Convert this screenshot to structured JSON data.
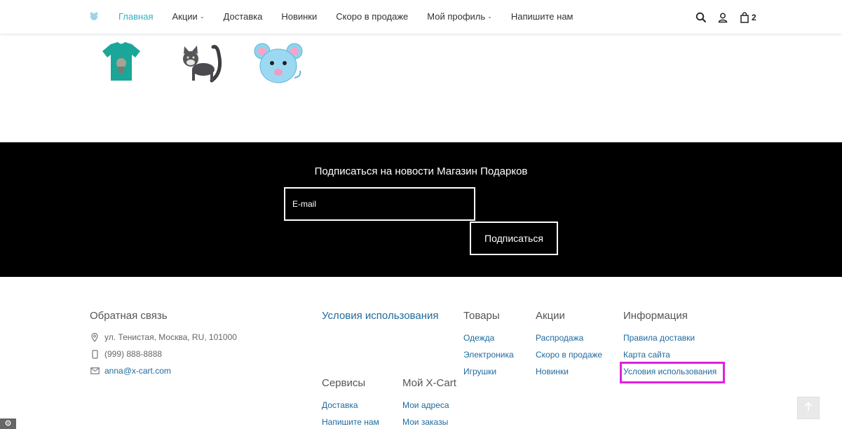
{
  "header": {
    "nav": [
      {
        "label": "Главная",
        "active": true,
        "dropdown": false
      },
      {
        "label": "Акции",
        "active": false,
        "dropdown": true
      },
      {
        "label": "Доставка",
        "active": false,
        "dropdown": false
      },
      {
        "label": "Новинки",
        "active": false,
        "dropdown": false
      },
      {
        "label": "Скоро в продаже",
        "active": false,
        "dropdown": false
      },
      {
        "label": "Мой профиль",
        "active": false,
        "dropdown": true
      },
      {
        "label": "Напишите нам",
        "active": false,
        "dropdown": false
      }
    ],
    "cart_count": "2",
    "icons": [
      "search-icon",
      "user-icon",
      "cart-icon"
    ],
    "accent_color": "#2fb0c8"
  },
  "products": [
    {
      "name": "t-shirt-thumbnail",
      "color": "#1aa79a"
    },
    {
      "name": "cat-thumbnail",
      "color": "#444444"
    },
    {
      "name": "mouse-thumbnail",
      "color": "#8fd3ef"
    }
  ],
  "newsletter": {
    "title": "Подписаться на новости Магазин Подарков",
    "placeholder": "E-mail",
    "button": "Подписаться"
  },
  "footer": {
    "contact": {
      "title": "Обратная связь",
      "address": "ул. Тенистая, Москва, RU, 101000",
      "phone": "(999) 888-8888",
      "email": "anna@x-cart.com"
    },
    "terms": "Условия использования",
    "products": {
      "title": "Товары",
      "links": [
        "Одежда",
        "Электроника",
        "Игрушки"
      ]
    },
    "promos": {
      "title": "Акции",
      "links": [
        "Распродажа",
        "Скоро в продаже",
        "Новинки"
      ]
    },
    "info": {
      "title": "Информация",
      "links": [
        "Правила доставки",
        "Карта сайта",
        "Условия использования"
      ]
    },
    "services": {
      "title": "Сервисы",
      "links": [
        "Доставка",
        "Напишите нам"
      ]
    },
    "myxcart": {
      "title": "Мой X-Cart",
      "links": [
        "Мои адреса",
        "Мои заказы"
      ]
    },
    "link_color": "#1f6a9e",
    "highlight_color": "#e020e0"
  }
}
